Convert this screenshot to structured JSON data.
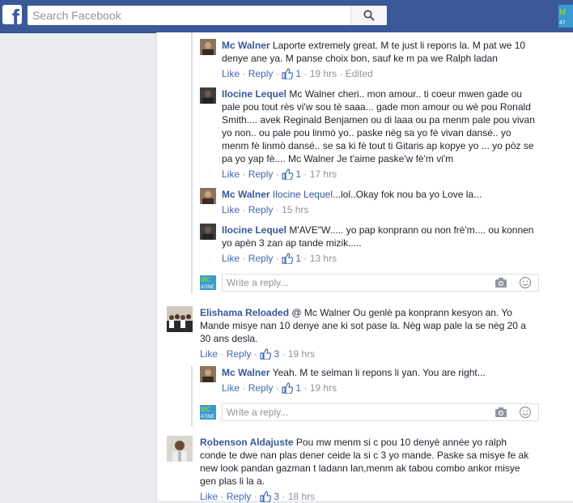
{
  "header": {
    "logo_letter": "f",
    "search_placeholder": "Search Facebook",
    "profile_logo": "MC 47INE"
  },
  "icons": {
    "logo": "facebook-logo",
    "search": "search-icon",
    "like": "thumbs-up-icon",
    "camera": "camera-icon",
    "emoji": "smiley-icon"
  },
  "colors": {
    "brand": "#3b5998",
    "link": "#365899",
    "action": "#4267b2",
    "muted": "#90949c",
    "background": "#e9ebee"
  },
  "labels": {
    "like": "Like",
    "reply": "Reply",
    "write_reply_placeholder": "Write a reply..."
  },
  "comments": [
    {
      "author": "Mc Walner",
      "text": "Laporte extremely great. M te just li repons la. M pat we 10 denye ane ya. M panse choix bon, sauf ke m pa we Ralph ladan",
      "likes": "1",
      "time": "19 hrs",
      "edited": "Edited"
    },
    {
      "author": "Ilocine Lequel",
      "text": "Mc Walner cheri.. mon amour.. ti coeur mwen gade ou pale pou tout rès vi'w sou tè saaa... gade mon amour ou wè pou Ronald Smith.... avek Reginald Benjamen ou di laaa ou pa menm pale pou vivan yo non.. ou pale pou linmò yo.. paske nèg sa yo fè vivan dansé.. yo menm fè linmò dansé.. se sa ki fè tout ti Gitaris ap kopye yo ... yo pòz se pa yo yap fè.... Mc Walner Je t'aime paske'w fè'm vi'm",
      "likes": "1",
      "time": "17 hrs"
    },
    {
      "author": "Mc Walner",
      "tag": "Ilocine Lequel",
      "text": "...lol..Okay fok nou ba yo Love la...",
      "time": "15 hrs"
    },
    {
      "author": "Ilocine Lequel",
      "text": "M'AVE\"W..... yo pap konprann ou non frè'm.... ou konnen yo apèn 3 zan ap tande mizik.....",
      "likes": "1",
      "time": "13 hrs"
    },
    {
      "author": "Elishama Reloaded",
      "text": "@ Mc Walner Ou genlè pa konprann kesyon an. Yo Mande misye nan 10 denye ane ki sot pase la. Nèg wap pale la se nèg 20 a 30 ans desla.",
      "likes": "3",
      "time": "19 hrs"
    },
    {
      "author": "Mc Walner",
      "text": "Yeah. M te selman li repons li yan. You are right...",
      "likes": "1",
      "time": "19 hrs"
    },
    {
      "author": "Robenson Aldajuste",
      "text": "Pou mw menm si c pou 10 denyè année yo ralph conde te dwe nan plas dener ceide la si c 3 yo mande. Paske sa misye fe ak new look pandan gazman t ladann lan,menm ak tabou combo ankor misye gen plas li la a.",
      "likes": "3",
      "time": "18 hrs"
    }
  ]
}
